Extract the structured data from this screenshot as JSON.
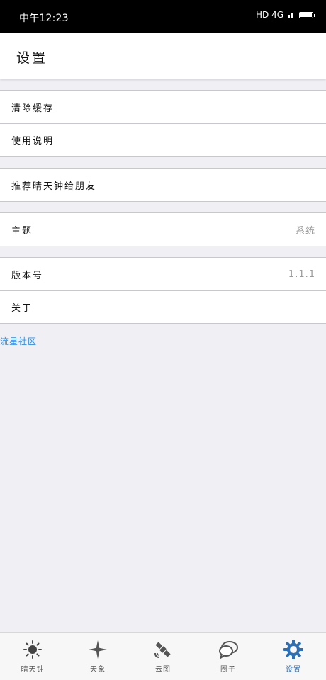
{
  "status_bar": {
    "time": "中午12:23",
    "network": "HD 4G"
  },
  "header": {
    "title": "设置"
  },
  "groups": [
    {
      "items": [
        {
          "label": "清除缓存"
        },
        {
          "label": "使用说明"
        }
      ]
    },
    {
      "items": [
        {
          "label": "推荐晴天钟给朋友"
        }
      ]
    },
    {
      "items": [
        {
          "label": "主题",
          "value": "系统"
        }
      ]
    },
    {
      "items": [
        {
          "label": "版本号",
          "value": "1.1.1"
        },
        {
          "label": "关于"
        }
      ]
    }
  ],
  "link": {
    "label": "流星社区"
  },
  "colors": {
    "accent": "#2d6fb5",
    "link": "#2f8ee0"
  },
  "tabs": [
    {
      "label": "晴天钟",
      "icon": "sun-icon"
    },
    {
      "label": "天象",
      "icon": "star-icon"
    },
    {
      "label": "云图",
      "icon": "satellite-icon"
    },
    {
      "label": "圈子",
      "icon": "chat-icon"
    },
    {
      "label": "设置",
      "icon": "gear-icon",
      "active": true
    }
  ]
}
